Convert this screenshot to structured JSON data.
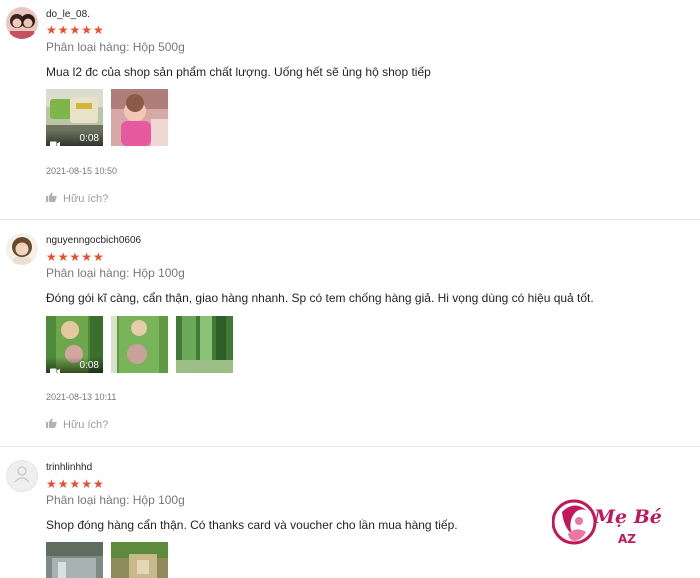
{
  "reviews": [
    {
      "username": "do_le_08.",
      "rating_stars": "★★★★★",
      "rating": 5,
      "variant": "Phân loại hàng: Hộp 500g",
      "comment": "Mua l2 đc của shop sản phẩm chất lượng. Uống hết sẽ ủng hộ shop tiếp",
      "video_duration": "0:08",
      "time": "2021-08-15 10:50",
      "helpful": "Hữu ích?"
    },
    {
      "username": "nguyenngocbich0606",
      "rating_stars": "★★★★★",
      "rating": 5,
      "variant": "Phân loại hàng: Hộp 100g",
      "comment": "Đóng gói kĩ càng, cẩn thận, giao hàng nhanh. Sp có tem chống hàng giả. Hi vọng dùng có hiệu quả tốt.",
      "video_duration": "0:08",
      "time": "2021-08-13 10:11",
      "helpful": "Hữu ích?"
    },
    {
      "username": "trinhlinhhd",
      "rating_stars": "★★★★★",
      "rating": 5,
      "variant": "Phân loại hàng: Hộp 100g",
      "comment": "Shop đóng hàng cẩn thận. Có thanks card và voucher cho lần mua hàng tiếp."
    }
  ],
  "watermark": {
    "brand": "Mẹ Bé",
    "suffix": "AZ"
  },
  "colors": {
    "star": "#ee4d2d",
    "logo": "#c2185b"
  },
  "icons": [
    "thumbs-up-icon",
    "video-camera-icon",
    "default-avatar-icon"
  ]
}
